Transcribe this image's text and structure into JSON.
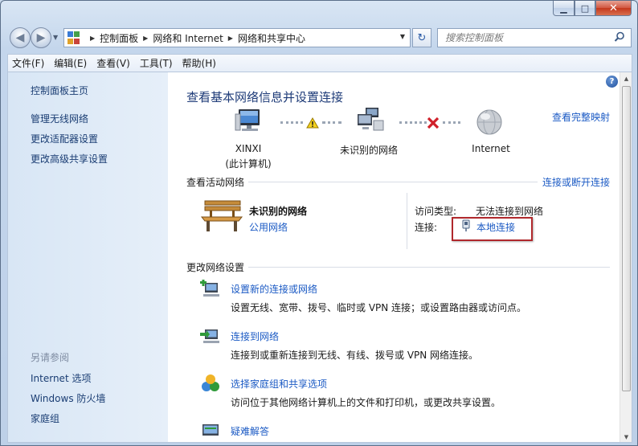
{
  "window": {
    "caption_buttons": [
      "minimize-icon",
      "maximize-icon",
      "close-icon"
    ]
  },
  "address_bar": {
    "crumbs": [
      "控制面板",
      "网络和 Internet",
      "网络和共享中心"
    ],
    "search_placeholder": "搜索控制面板"
  },
  "menu": [
    "文件(F)",
    "编辑(E)",
    "查看(V)",
    "工具(T)",
    "帮助(H)"
  ],
  "sidebar": {
    "home": "控制面板主页",
    "links": [
      "管理无线网络",
      "更改适配器设置",
      "更改高级共享设置"
    ],
    "see_also_title": "另请参阅",
    "see_also": [
      "Internet 选项",
      "Windows 防火墙",
      "家庭组"
    ]
  },
  "main": {
    "title": "查看基本网络信息并设置连接",
    "full_map": "查看完整映射",
    "map_nodes": [
      {
        "name": "XINXI",
        "sub": "(此计算机)"
      },
      {
        "name": "未识别的网络",
        "sub": ""
      },
      {
        "name": "Internet",
        "sub": ""
      }
    ],
    "active_header": "查看活动网络",
    "connect_disconnect": "连接或断开连接",
    "network_name": "未识别的网络",
    "network_type": "公用网络",
    "access_label": "访问类型:",
    "access_value": "无法连接到网络",
    "conn_label": "连接:",
    "conn_value": "本地连接",
    "change_header": "更改网络设置",
    "settings": [
      {
        "title": "设置新的连接或网络",
        "desc": "设置无线、宽带、拨号、临时或 VPN 连接；或设置路由器或访问点。"
      },
      {
        "title": "连接到网络",
        "desc": "连接到或重新连接到无线、有线、拨号或 VPN 网络连接。"
      },
      {
        "title": "选择家庭组和共享选项",
        "desc": "访问位于其他网络计算机上的文件和打印机，或更改共享设置。"
      },
      {
        "title": "疑难解答",
        "desc": ""
      }
    ]
  },
  "colors": {
    "link": "#1b5ac4",
    "title": "#1e3b78",
    "highlight_box": "#b0282c",
    "sidebar_bg": "#dce8f6"
  }
}
